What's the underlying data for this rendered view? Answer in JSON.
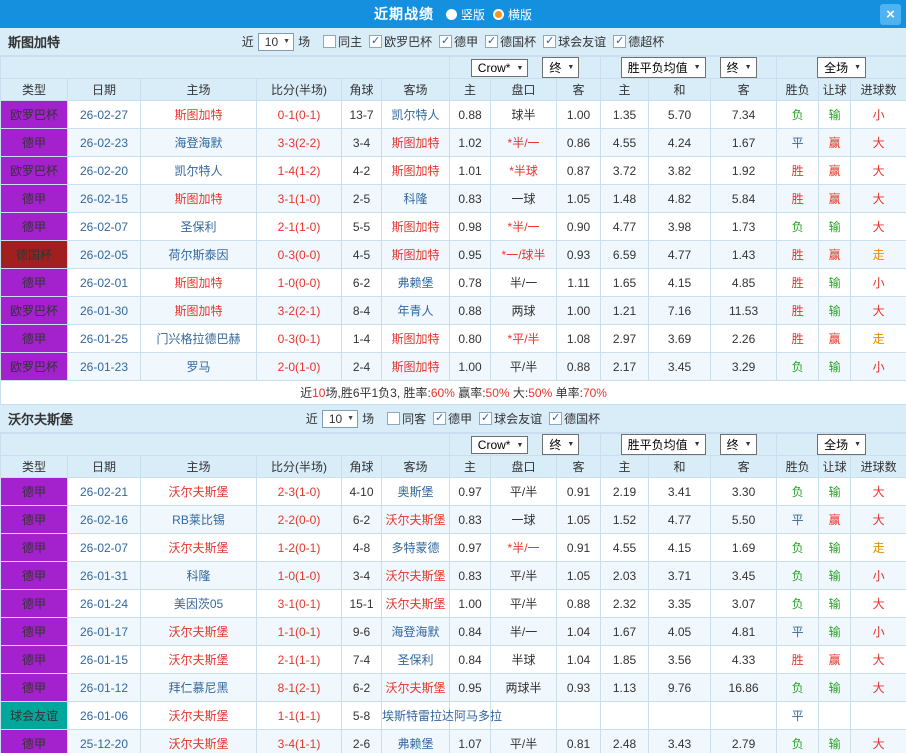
{
  "titlebar": {
    "title": "近期战绩",
    "radios": [
      {
        "label": "竖版",
        "selected": false
      },
      {
        "label": "横版",
        "selected": true
      }
    ],
    "close_icon": "×"
  },
  "colors": {
    "type_badges": {
      "欧罗巴杯": "#A421CE",
      "德甲": "#A421CE",
      "德国杯": "#A02020",
      "球会友谊": "#00A89B"
    },
    "focus_team": "#E5352B",
    "other_team": "#33679E",
    "date": "#33679E",
    "score": "#E5352B",
    "handicap_star": "#E5352B",
    "status": {
      "胜": "#E5352B",
      "平": "#33679E",
      "负": "#28A428",
      "赢": "#E5352B",
      "输": "#28A428",
      "大": "#E5352B",
      "小": "#E5352B",
      "走": "#EF8C00"
    }
  },
  "columns": [
    "类型",
    "日期",
    "主场",
    "比分(半场)",
    "角球",
    "客场",
    "主",
    "盘口",
    "客",
    "主",
    "和",
    "客",
    "胜负",
    "让球",
    "进球数"
  ],
  "sections": [
    {
      "team": "斯图加特",
      "near": {
        "prefix": "近",
        "count": "10",
        "suffix": "场"
      },
      "checkboxes": [
        {
          "label": "同主",
          "checked": false
        },
        {
          "label": "欧罗巴杯",
          "checked": true
        },
        {
          "label": "德甲",
          "checked": true
        },
        {
          "label": "德国杯",
          "checked": true
        },
        {
          "label": "球会友谊",
          "checked": true
        },
        {
          "label": "德超杯",
          "checked": true
        }
      ],
      "filters": {
        "company": "Crow*",
        "final_a": "终",
        "avg": "胜平负均值",
        "final_b": "终",
        "scope": "全场"
      },
      "rows": [
        {
          "type": "欧罗巴杯",
          "date": "26-02-27",
          "home": "斯图加特",
          "home_focus": true,
          "score": "0-1(0-1)",
          "corner": "13-7",
          "away": "凯尔特人",
          "away_focus": false,
          "h": "0.88",
          "handicap": "球半",
          "handicap_red": false,
          "a": "1.00",
          "w": "1.35",
          "d": "5.70",
          "l": "7.34",
          "result": "负",
          "covered": "输",
          "goals": "小"
        },
        {
          "type": "德甲",
          "date": "26-02-23",
          "home": "海登海默",
          "home_focus": false,
          "score": "3-3(2-2)",
          "corner": "3-4",
          "away": "斯图加特",
          "away_focus": true,
          "h": "1.02",
          "handicap": "*半/一",
          "handicap_red": true,
          "a": "0.86",
          "w": "4.55",
          "d": "4.24",
          "l": "1.67",
          "result": "平",
          "covered": "赢",
          "goals": "大"
        },
        {
          "type": "欧罗巴杯",
          "date": "26-02-20",
          "home": "凯尔特人",
          "home_focus": false,
          "score": "1-4(1-2)",
          "corner": "4-2",
          "away": "斯图加特",
          "away_focus": true,
          "h": "1.01",
          "handicap": "*半球",
          "handicap_red": true,
          "a": "0.87",
          "w": "3.72",
          "d": "3.82",
          "l": "1.92",
          "result": "胜",
          "covered": "赢",
          "goals": "大"
        },
        {
          "type": "德甲",
          "date": "26-02-15",
          "home": "斯图加特",
          "home_focus": true,
          "score": "3-1(1-0)",
          "corner": "2-5",
          "away": "科隆",
          "away_focus": false,
          "h": "0.83",
          "handicap": "一球",
          "handicap_red": false,
          "a": "1.05",
          "w": "1.48",
          "d": "4.82",
          "l": "5.84",
          "result": "胜",
          "covered": "赢",
          "goals": "大"
        },
        {
          "type": "德甲",
          "date": "26-02-07",
          "home": "圣保利",
          "home_focus": false,
          "score": "2-1(1-0)",
          "corner": "5-5",
          "away": "斯图加特",
          "away_focus": true,
          "h": "0.98",
          "handicap": "*半/一",
          "handicap_red": true,
          "a": "0.90",
          "w": "4.77",
          "d": "3.98",
          "l": "1.73",
          "result": "负",
          "covered": "输",
          "goals": "大"
        },
        {
          "type": "德国杯",
          "date": "26-02-05",
          "home": "荷尔斯泰因",
          "home_focus": false,
          "score": "0-3(0-0)",
          "corner": "4-5",
          "away": "斯图加特",
          "away_focus": true,
          "h": "0.95",
          "handicap": "*一/球半",
          "handicap_red": true,
          "a": "0.93",
          "w": "6.59",
          "d": "4.77",
          "l": "1.43",
          "result": "胜",
          "covered": "赢",
          "goals": "走"
        },
        {
          "type": "德甲",
          "date": "26-02-01",
          "home": "斯图加特",
          "home_focus": true,
          "score": "1-0(0-0)",
          "corner": "6-2",
          "away": "弗赖堡",
          "away_focus": false,
          "h": "0.78",
          "handicap": "半/一",
          "handicap_red": false,
          "a": "1.11",
          "w": "1.65",
          "d": "4.15",
          "l": "4.85",
          "result": "胜",
          "covered": "输",
          "goals": "小"
        },
        {
          "type": "欧罗巴杯",
          "date": "26-01-30",
          "home": "斯图加特",
          "home_focus": true,
          "score": "3-2(2-1)",
          "corner": "8-4",
          "away": "年青人",
          "away_focus": false,
          "h": "0.88",
          "handicap": "两球",
          "handicap_red": false,
          "a": "1.00",
          "w": "1.21",
          "d": "7.16",
          "l": "11.53",
          "result": "胜",
          "covered": "输",
          "goals": "大"
        },
        {
          "type": "德甲",
          "date": "26-01-25",
          "home": "门兴格拉德巴赫",
          "home_focus": false,
          "score": "0-3(0-1)",
          "corner": "1-4",
          "away": "斯图加特",
          "away_focus": true,
          "h": "0.80",
          "handicap": "*平/半",
          "handicap_red": true,
          "a": "1.08",
          "w": "2.97",
          "d": "3.69",
          "l": "2.26",
          "result": "胜",
          "covered": "赢",
          "goals": "走"
        },
        {
          "type": "欧罗巴杯",
          "date": "26-01-23",
          "home": "罗马",
          "home_focus": false,
          "score": "2-0(1-0)",
          "corner": "2-4",
          "away": "斯图加特",
          "away_focus": true,
          "h": "1.00",
          "handicap": "平/半",
          "handicap_red": false,
          "a": "0.88",
          "w": "2.17",
          "d": "3.45",
          "l": "3.29",
          "result": "负",
          "covered": "输",
          "goals": "小"
        }
      ],
      "summary": [
        {
          "text": "近",
          "red": false
        },
        {
          "text": "10",
          "red": true
        },
        {
          "text": "场,胜6平1负3, 胜率:",
          "red": false
        },
        {
          "text": "60%",
          "red": true
        },
        {
          "text": " 赢率:",
          "red": false
        },
        {
          "text": "50%",
          "red": true
        },
        {
          "text": " 大:",
          "red": false
        },
        {
          "text": "50%",
          "red": true
        },
        {
          "text": " 单率:",
          "red": false
        },
        {
          "text": "70%",
          "red": true
        }
      ]
    },
    {
      "team": "沃尔夫斯堡",
      "near": {
        "prefix": "近",
        "count": "10",
        "suffix": "场"
      },
      "checkboxes": [
        {
          "label": "同客",
          "checked": false
        },
        {
          "label": "德甲",
          "checked": true
        },
        {
          "label": "球会友谊",
          "checked": true
        },
        {
          "label": "德国杯",
          "checked": true
        }
      ],
      "filters": {
        "company": "Crow*",
        "final_a": "终",
        "avg": "胜平负均值",
        "final_b": "终",
        "scope": "全场"
      },
      "rows": [
        {
          "type": "德甲",
          "date": "26-02-21",
          "home": "沃尔夫斯堡",
          "home_focus": true,
          "score": "2-3(1-0)",
          "corner": "4-10",
          "away": "奥斯堡",
          "away_focus": false,
          "h": "0.97",
          "handicap": "平/半",
          "handicap_red": false,
          "a": "0.91",
          "w": "2.19",
          "d": "3.41",
          "l": "3.30",
          "result": "负",
          "covered": "输",
          "goals": "大"
        },
        {
          "type": "德甲",
          "date": "26-02-16",
          "home": "RB莱比锡",
          "home_focus": false,
          "score": "2-2(0-0)",
          "corner": "6-2",
          "away": "沃尔夫斯堡",
          "away_focus": true,
          "h": "0.83",
          "handicap": "一球",
          "handicap_red": false,
          "a": "1.05",
          "w": "1.52",
          "d": "4.77",
          "l": "5.50",
          "result": "平",
          "covered": "赢",
          "goals": "大"
        },
        {
          "type": "德甲",
          "date": "26-02-07",
          "home": "沃尔夫斯堡",
          "home_focus": true,
          "score": "1-2(0-1)",
          "corner": "4-8",
          "away": "多特蒙德",
          "away_focus": false,
          "h": "0.97",
          "handicap": "*半/一",
          "handicap_red": true,
          "a": "0.91",
          "w": "4.55",
          "d": "4.15",
          "l": "1.69",
          "result": "负",
          "covered": "输",
          "goals": "走"
        },
        {
          "type": "德甲",
          "date": "26-01-31",
          "home": "科隆",
          "home_focus": false,
          "score": "1-0(1-0)",
          "corner": "3-4",
          "away": "沃尔夫斯堡",
          "away_focus": true,
          "h": "0.83",
          "handicap": "平/半",
          "handicap_red": false,
          "a": "1.05",
          "w": "2.03",
          "d": "3.71",
          "l": "3.45",
          "result": "负",
          "covered": "输",
          "goals": "小"
        },
        {
          "type": "德甲",
          "date": "26-01-24",
          "home": "美因茨05",
          "home_focus": false,
          "score": "3-1(0-1)",
          "corner": "15-1",
          "away": "沃尔夫斯堡",
          "away_focus": true,
          "h": "1.00",
          "handicap": "平/半",
          "handicap_red": false,
          "a": "0.88",
          "w": "2.32",
          "d": "3.35",
          "l": "3.07",
          "result": "负",
          "covered": "输",
          "goals": "大"
        },
        {
          "type": "德甲",
          "date": "26-01-17",
          "home": "沃尔夫斯堡",
          "home_focus": true,
          "score": "1-1(0-1)",
          "corner": "9-6",
          "away": "海登海默",
          "away_focus": false,
          "h": "0.84",
          "handicap": "半/一",
          "handicap_red": false,
          "a": "1.04",
          "w": "1.67",
          "d": "4.05",
          "l": "4.81",
          "result": "平",
          "covered": "输",
          "goals": "小"
        },
        {
          "type": "德甲",
          "date": "26-01-15",
          "home": "沃尔夫斯堡",
          "home_focus": true,
          "score": "2-1(1-1)",
          "corner": "7-4",
          "away": "圣保利",
          "away_focus": false,
          "h": "0.84",
          "handicap": "半球",
          "handicap_red": false,
          "a": "1.04",
          "w": "1.85",
          "d": "3.56",
          "l": "4.33",
          "result": "胜",
          "covered": "赢",
          "goals": "大"
        },
        {
          "type": "德甲",
          "date": "26-01-12",
          "home": "拜仁慕尼黑",
          "home_focus": false,
          "score": "8-1(2-1)",
          "corner": "6-2",
          "away": "沃尔夫斯堡",
          "away_focus": true,
          "h": "0.95",
          "handicap": "两球半",
          "handicap_red": false,
          "a": "0.93",
          "w": "1.13",
          "d": "9.76",
          "l": "16.86",
          "result": "负",
          "covered": "输",
          "goals": "大"
        },
        {
          "type": "球会友谊",
          "date": "26-01-06",
          "home": "沃尔夫斯堡",
          "home_focus": true,
          "score": "1-1(1-1)",
          "corner": "5-8",
          "away": "埃斯特雷拉达阿马多拉",
          "away_focus": false,
          "h": "",
          "handicap": "",
          "handicap_red": false,
          "a": "",
          "w": "",
          "d": "",
          "l": "",
          "result": "平",
          "covered": "",
          "goals": ""
        },
        {
          "type": "德甲",
          "date": "25-12-20",
          "home": "沃尔夫斯堡",
          "home_focus": true,
          "score": "3-4(1-1)",
          "corner": "2-6",
          "away": "弗赖堡",
          "away_focus": false,
          "h": "1.07",
          "handicap": "平/半",
          "handicap_red": false,
          "a": "0.81",
          "w": "2.48",
          "d": "3.43",
          "l": "2.79",
          "result": "负",
          "covered": "输",
          "goals": "大"
        }
      ],
      "summary": []
    }
  ]
}
